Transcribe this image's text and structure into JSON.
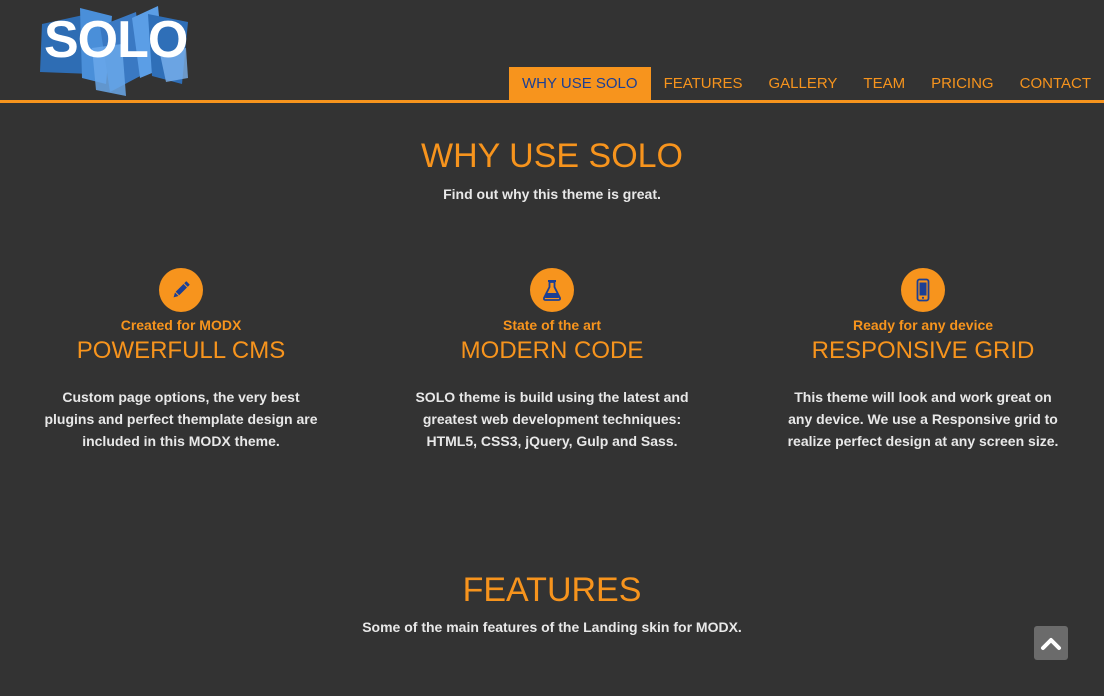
{
  "brand": {
    "logo_text": "SOLO"
  },
  "colors": {
    "background": "#333333",
    "accent": "#f7941d",
    "active_text": "#1c3f94",
    "body_text": "#e8e8e8",
    "logo_blue": "#3a79c3"
  },
  "nav": {
    "items": [
      {
        "label": "WHY USE SOLO",
        "active": true
      },
      {
        "label": "FEATURES",
        "active": false
      },
      {
        "label": "GALLERY",
        "active": false
      },
      {
        "label": "TEAM",
        "active": false
      },
      {
        "label": "PRICING",
        "active": false
      },
      {
        "label": "CONTACT",
        "active": false
      }
    ]
  },
  "why": {
    "title": "WHY USE SOLO",
    "subtitle": "Find out why this theme is great.",
    "columns": [
      {
        "icon": "pencil-icon",
        "tag": "Created for MODX",
        "title": "POWERFULL CMS",
        "text": "Custom page options, the very best plugins and perfect themplate design are included in this MODX theme."
      },
      {
        "icon": "flask-icon",
        "tag": "State of the art",
        "title": "MODERN CODE",
        "text": "SOLO theme is build using the latest and greatest web development techniques: HTML5, CSS3, jQuery, Gulp and Sass."
      },
      {
        "icon": "mobile-phone-icon",
        "tag": "Ready for any device",
        "title": "RESPONSIVE GRID",
        "text": "This theme will look and work great on any device. We use a Responsive grid to realize perfect design at any screen size."
      }
    ]
  },
  "features": {
    "title": "FEATURES",
    "subtitle": "Some of the main features of the Landing skin for MODX."
  },
  "scroll_top": {
    "icon": "chevron-up-icon"
  }
}
